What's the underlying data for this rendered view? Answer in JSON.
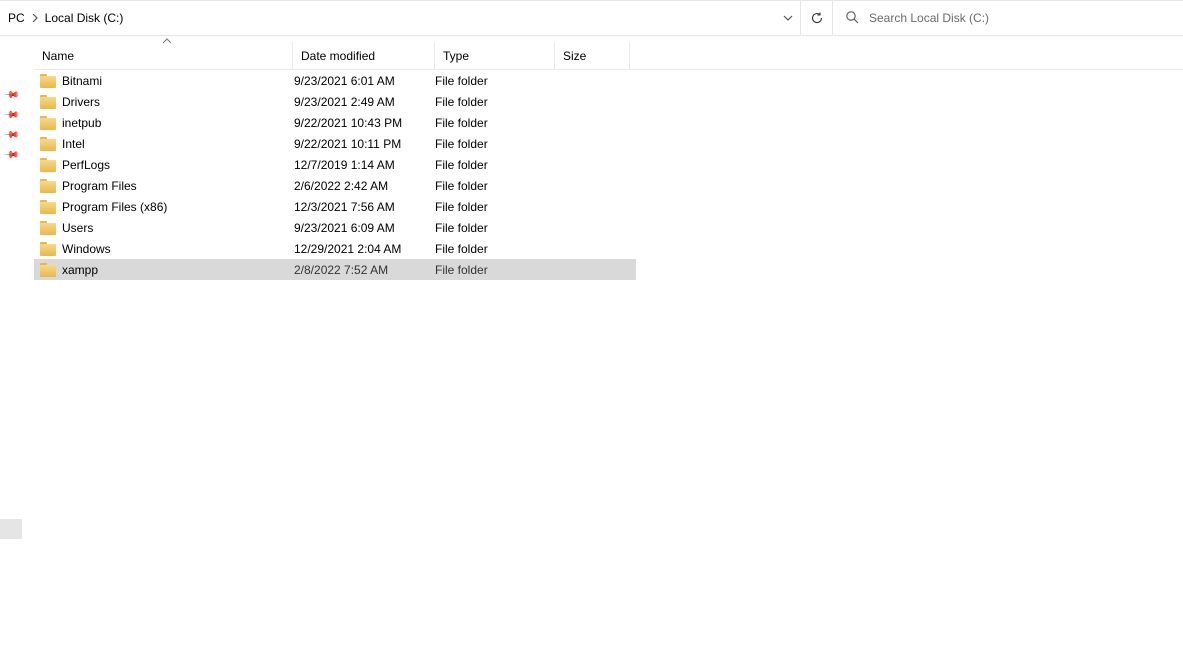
{
  "breadcrumb": {
    "items": [
      "PC",
      "Local Disk (C:)"
    ]
  },
  "search": {
    "placeholder": "Search Local Disk (C:)"
  },
  "columns": {
    "name": "Name",
    "date": "Date modified",
    "type": "Type",
    "size": "Size"
  },
  "rows": [
    {
      "name": "Bitnami",
      "date": "9/23/2021 6:01 AM",
      "type": "File folder",
      "size": "",
      "selected": false
    },
    {
      "name": "Drivers",
      "date": "9/23/2021 2:49 AM",
      "type": "File folder",
      "size": "",
      "selected": false
    },
    {
      "name": "inetpub",
      "date": "9/22/2021 10:43 PM",
      "type": "File folder",
      "size": "",
      "selected": false
    },
    {
      "name": "Intel",
      "date": "9/22/2021 10:11 PM",
      "type": "File folder",
      "size": "",
      "selected": false
    },
    {
      "name": "PerfLogs",
      "date": "12/7/2019 1:14 AM",
      "type": "File folder",
      "size": "",
      "selected": false
    },
    {
      "name": "Program Files",
      "date": "2/6/2022 2:42 AM",
      "type": "File folder",
      "size": "",
      "selected": false
    },
    {
      "name": "Program Files (x86)",
      "date": "12/3/2021 7:56 AM",
      "type": "File folder",
      "size": "",
      "selected": false
    },
    {
      "name": "Users",
      "date": "9/23/2021 6:09 AM",
      "type": "File folder",
      "size": "",
      "selected": false
    },
    {
      "name": "Windows",
      "date": "12/29/2021 2:04 AM",
      "type": "File folder",
      "size": "",
      "selected": false
    },
    {
      "name": "xampp",
      "date": "2/8/2022 7:52 AM",
      "type": "File folder",
      "size": "",
      "selected": true
    }
  ]
}
